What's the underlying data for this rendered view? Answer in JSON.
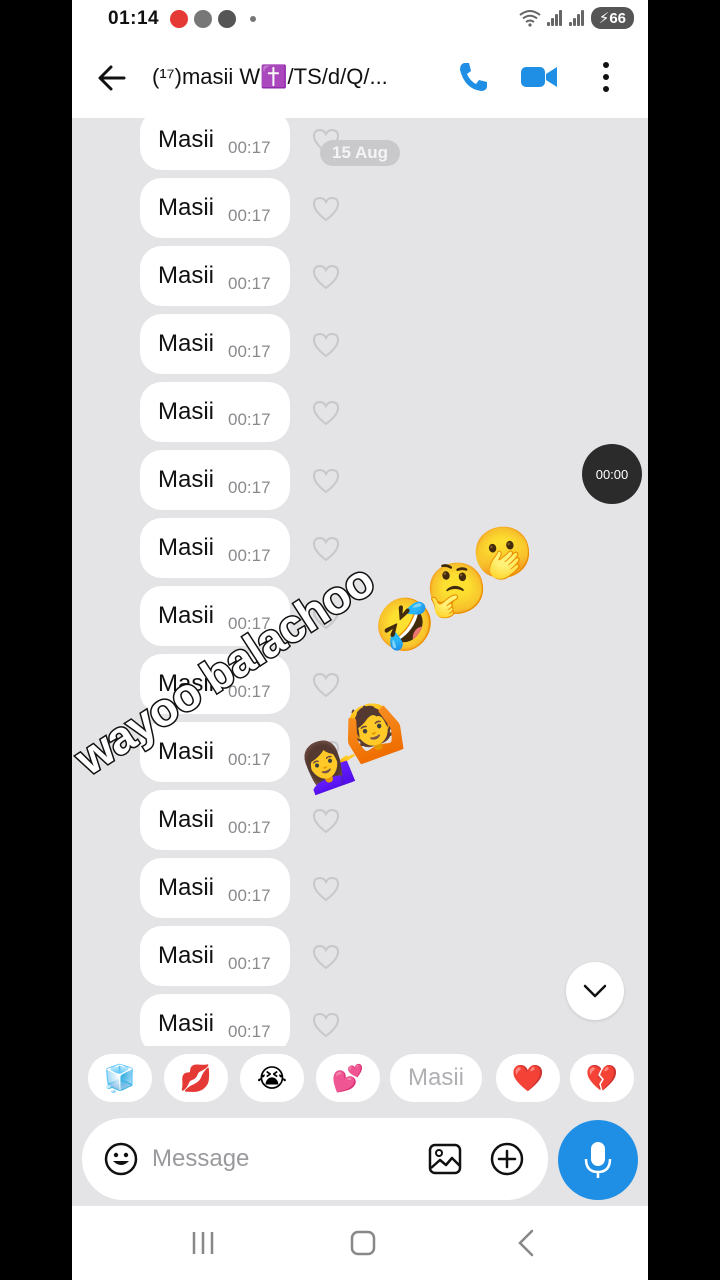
{
  "status_bar": {
    "time": "01:14",
    "battery": "66"
  },
  "header": {
    "title": "(¹⁷)masii W✝️/TS/d/Q/..."
  },
  "date_separator": "15 Aug",
  "timer_badge": "00:00",
  "messages": [
    {
      "text": "Masii",
      "time": "00:17"
    },
    {
      "text": "Masii",
      "time": "00:17"
    },
    {
      "text": "Masii",
      "time": "00:17"
    },
    {
      "text": "Masii",
      "time": "00:17"
    },
    {
      "text": "Masii",
      "time": "00:17"
    },
    {
      "text": "Masii",
      "time": "00:17"
    },
    {
      "text": "Masii",
      "time": "00:17"
    },
    {
      "text": "Masii",
      "time": "00:17"
    },
    {
      "text": "Masii",
      "time": "00:17"
    },
    {
      "text": "Masii",
      "time": "00:17"
    },
    {
      "text": "Masii",
      "time": "00:17"
    },
    {
      "text": "Masii",
      "time": "00:17"
    },
    {
      "text": "Masii",
      "time": "00:17"
    },
    {
      "text": "Masii",
      "time": "00:17"
    }
  ],
  "overlay": {
    "text": "wayoo balachoo",
    "emojis": [
      "🫢",
      "🤔",
      "🤣",
      "🙆",
      "💁‍♀️"
    ]
  },
  "quick_replies": [
    {
      "kind": "emoji",
      "value": "🧊"
    },
    {
      "kind": "emoji",
      "value": "💋"
    },
    {
      "kind": "emoji",
      "value": "😭"
    },
    {
      "kind": "emoji",
      "value": "💕"
    },
    {
      "kind": "text",
      "value": "Masii"
    },
    {
      "kind": "emoji",
      "value": "❤️"
    },
    {
      "kind": "emoji",
      "value": "💔"
    }
  ],
  "composer": {
    "placeholder": "Message"
  },
  "colors": {
    "accent": "#1f8fe6",
    "chat_background": "#e4e4e6",
    "bubble": "#ffffff"
  },
  "icons": {
    "back": "arrow-left-icon",
    "call": "phone-icon",
    "video": "video-camera-icon",
    "more": "more-vertical-icon",
    "heart": "heart-outline-icon",
    "emoji": "smiley-icon",
    "gallery": "image-icon",
    "add": "plus-circle-icon",
    "mic": "microphone-icon",
    "scroll": "chevron-down-icon"
  }
}
